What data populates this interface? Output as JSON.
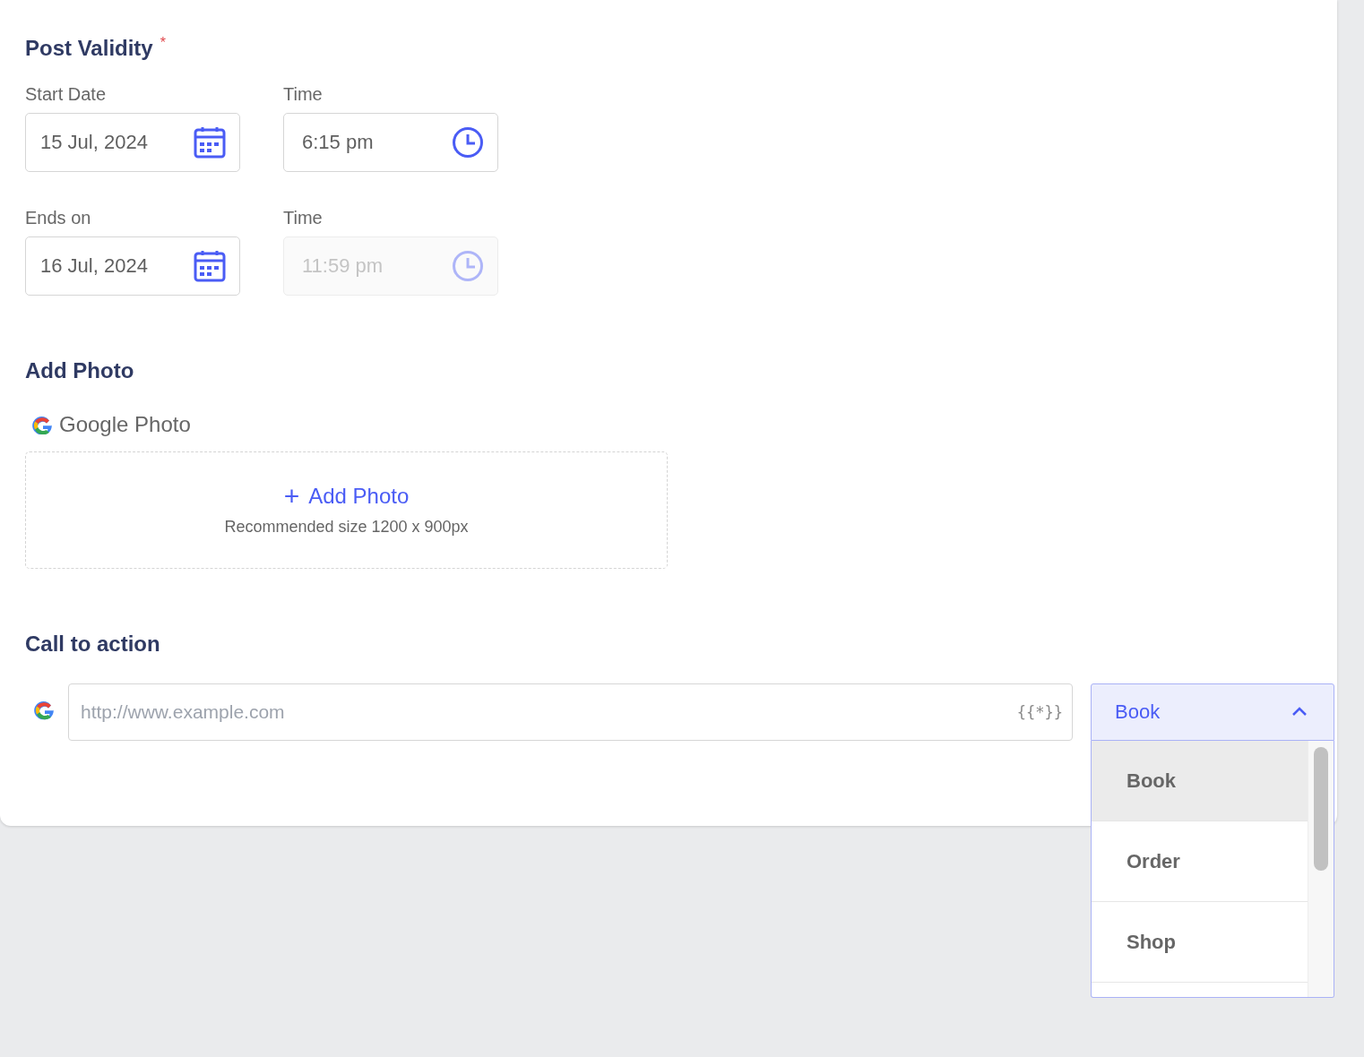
{
  "post_validity": {
    "title": "Post Validity",
    "required_mark": "*",
    "rows": [
      {
        "date": {
          "label": "Start Date",
          "value": "15 Jul, 2024",
          "disabled": false
        },
        "time": {
          "label": "Time",
          "value": "6:15 pm",
          "disabled": false
        }
      },
      {
        "date": {
          "label": "Ends on",
          "value": "16 Jul, 2024",
          "disabled": false
        },
        "time": {
          "label": "Time",
          "value": "11:59 pm",
          "disabled": true
        }
      }
    ]
  },
  "add_photo": {
    "title": "Add Photo",
    "source": "Google Photo",
    "button": "Add Photo",
    "button_icon": "+",
    "hint": "Recommended size 1200 x 900px"
  },
  "call_to_action": {
    "title": "Call to action",
    "url_placeholder": "http://www.example.com",
    "variables_label": "{{*}}",
    "dropdown": {
      "value": "Book",
      "expanded": true,
      "options": [
        {
          "label": "Book",
          "selected": true
        },
        {
          "label": "Order",
          "selected": false
        },
        {
          "label": "Shop",
          "selected": false
        }
      ]
    }
  }
}
